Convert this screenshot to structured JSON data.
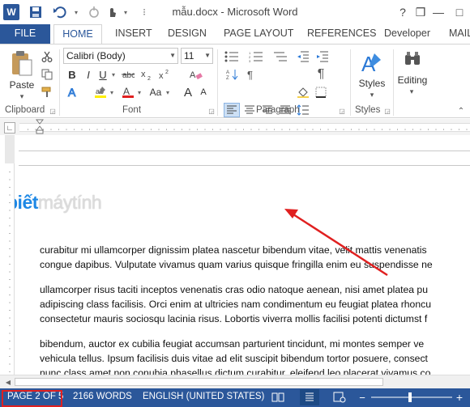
{
  "window": {
    "title": "mẫu.docx - Microsoft Word",
    "controls": [
      "?",
      "❒",
      "—",
      "□"
    ]
  },
  "tabs": [
    {
      "label": "FILE"
    },
    {
      "label": "HOME"
    },
    {
      "label": "INSERT"
    },
    {
      "label": "DESIGN"
    },
    {
      "label": "PAGE LAYOUT"
    },
    {
      "label": "REFERENCES"
    },
    {
      "label": "Developer"
    },
    {
      "label": "MAIL"
    }
  ],
  "ribbon": {
    "paste_label": "Paste",
    "font_name": "Calibri (Body)",
    "font_size": "11",
    "bold": "B",
    "italic": "I",
    "underline": "U",
    "grow_font": "A",
    "shrink_font": "A",
    "change_case": "Aa",
    "styles_label": "Styles",
    "editing_label": "Editing",
    "groups": {
      "clipboard": "Clipboard",
      "font": "Font",
      "paragraph": "Paragraph",
      "styles": "Styles"
    }
  },
  "document": {
    "watermark": {
      "brand": "biết",
      "rest": "máytính"
    },
    "paragraphs": [
      [
        "curabitur mi ullamcorper dignissim platea nascetur bibendum vitae, velit mattis venenatis",
        "congue dapibus. Vulputate vivamus quam varius quisque fringilla enim eu suspendisse ne"
      ],
      [
        "ullamcorper risus taciti inceptos venenatis cras odio natoque aenean, nisi amet platea pu",
        "adipiscing class facilisis. Orci enim at ultricies nam condimentum eu feugiat platea rhoncu",
        "consectetur mauris sociosqu lacinia risus. Lobortis viverra mollis facilisi potenti dictumst f"
      ],
      [
        " bibendum, auctor ex cubilia feugiat accumsan parturient tincidunt, mi montes semper ve",
        "vehicula tellus. Ipsum facilisis duis vitae ad elit suscipit bibendum tortor posuere, consect",
        "nunc class amet non conubia phasellus dictum curabitur, eleifend leo placerat vivamus co"
      ]
    ]
  },
  "statusbar": {
    "page": "PAGE 2 OF 5",
    "words": "2166 WORDS",
    "language": "ENGLISH (UNITED STATES)"
  },
  "colors": {
    "accent": "#2b579a",
    "highlight_box": "#e02020",
    "arrow": "#e02020"
  }
}
